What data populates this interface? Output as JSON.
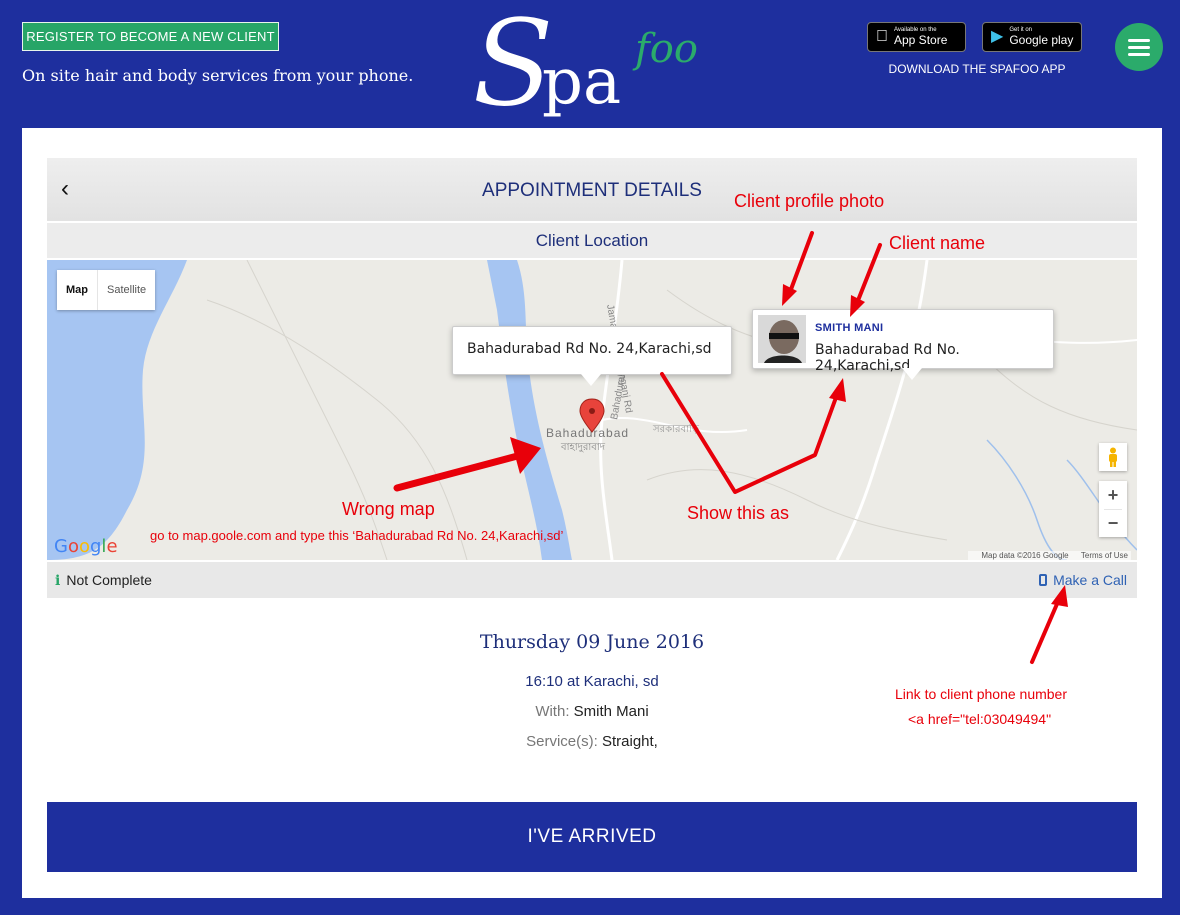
{
  "header": {
    "register_label": "REGISTER TO BECOME A NEW CLIENT",
    "tagline": "On site hair and body services from your phone.",
    "logo_main": "Spa",
    "logo_sub": "foo",
    "appstore_small": "Available on the",
    "appstore_big": "App Store",
    "googleplay_small": "Get it on",
    "googleplay_big": "Google play",
    "download_text": "DOWNLOAD THE SPAFOO APP"
  },
  "appointment": {
    "title": "APPOINTMENT DETAILS",
    "location_heading": "Client Location",
    "status": "Not Complete",
    "call_label": "Make a Call",
    "date": "Thursday 09 June 2016",
    "time_place": "16:10 at Karachi, sd",
    "with_label": "With:",
    "with_value": "Smith Mani",
    "services_label": "Service(s):",
    "services_value": "Straight,",
    "arrived_label": "I'VE ARRIVED"
  },
  "map": {
    "type_map": "Map",
    "type_satellite": "Satellite",
    "place_label": "Bahadurabad",
    "place_label_bn": "বাহাদুরাবাদ",
    "road_label": "Bahadurabad Rd",
    "road_label2": "Jamalpur-Dewanganj Rd",
    "side_label": "সরকারবাড়ি",
    "marker_address": "Bahadurabad Rd No. 24,Karachi,sd",
    "client_name": "SMITH MANI",
    "client_address": "Bahadurabad Rd No. 24,Karachi,sd",
    "google_logo": "Google",
    "map_data": "Map data ©2016 Google",
    "terms": "Terms of Use",
    "zoom_in": "+",
    "zoom_out": "−"
  },
  "annotations": {
    "profile_photo": "Client profile photo",
    "client_name": "Client name",
    "wrong_map": "Wrong map",
    "wrong_map_hint": "go to map.goole.com and type this ‘Bahadurabad Rd No. 24,Karachi,sd’",
    "show_this": "Show this as",
    "phone_link_1": "Link to client phone number",
    "phone_link_2": "<a href=\"tel:03049494\""
  },
  "colors": {
    "brand_blue": "#1e2f9e",
    "brand_green": "#27a567",
    "annotation_red": "#e8000a"
  }
}
